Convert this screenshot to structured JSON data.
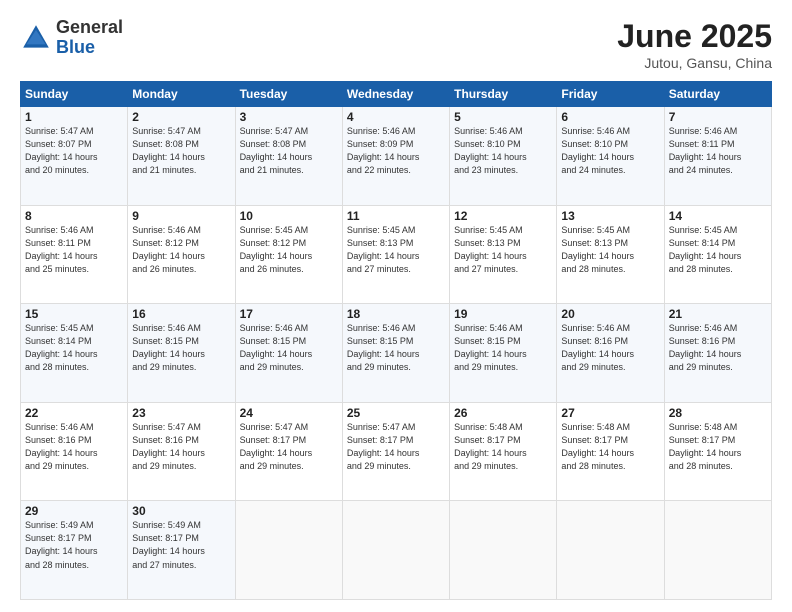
{
  "logo": {
    "general": "General",
    "blue": "Blue"
  },
  "title": {
    "month": "June 2025",
    "location": "Jutou, Gansu, China"
  },
  "weekdays": [
    "Sunday",
    "Monday",
    "Tuesday",
    "Wednesday",
    "Thursday",
    "Friday",
    "Saturday"
  ],
  "weeks": [
    [
      {
        "day": "1",
        "info": "Sunrise: 5:47 AM\nSunset: 8:07 PM\nDaylight: 14 hours\nand 20 minutes."
      },
      {
        "day": "2",
        "info": "Sunrise: 5:47 AM\nSunset: 8:08 PM\nDaylight: 14 hours\nand 21 minutes."
      },
      {
        "day": "3",
        "info": "Sunrise: 5:47 AM\nSunset: 8:08 PM\nDaylight: 14 hours\nand 21 minutes."
      },
      {
        "day": "4",
        "info": "Sunrise: 5:46 AM\nSunset: 8:09 PM\nDaylight: 14 hours\nand 22 minutes."
      },
      {
        "day": "5",
        "info": "Sunrise: 5:46 AM\nSunset: 8:10 PM\nDaylight: 14 hours\nand 23 minutes."
      },
      {
        "day": "6",
        "info": "Sunrise: 5:46 AM\nSunset: 8:10 PM\nDaylight: 14 hours\nand 24 minutes."
      },
      {
        "day": "7",
        "info": "Sunrise: 5:46 AM\nSunset: 8:11 PM\nDaylight: 14 hours\nand 24 minutes."
      }
    ],
    [
      {
        "day": "8",
        "info": "Sunrise: 5:46 AM\nSunset: 8:11 PM\nDaylight: 14 hours\nand 25 minutes."
      },
      {
        "day": "9",
        "info": "Sunrise: 5:46 AM\nSunset: 8:12 PM\nDaylight: 14 hours\nand 26 minutes."
      },
      {
        "day": "10",
        "info": "Sunrise: 5:45 AM\nSunset: 8:12 PM\nDaylight: 14 hours\nand 26 minutes."
      },
      {
        "day": "11",
        "info": "Sunrise: 5:45 AM\nSunset: 8:13 PM\nDaylight: 14 hours\nand 27 minutes."
      },
      {
        "day": "12",
        "info": "Sunrise: 5:45 AM\nSunset: 8:13 PM\nDaylight: 14 hours\nand 27 minutes."
      },
      {
        "day": "13",
        "info": "Sunrise: 5:45 AM\nSunset: 8:13 PM\nDaylight: 14 hours\nand 28 minutes."
      },
      {
        "day": "14",
        "info": "Sunrise: 5:45 AM\nSunset: 8:14 PM\nDaylight: 14 hours\nand 28 minutes."
      }
    ],
    [
      {
        "day": "15",
        "info": "Sunrise: 5:45 AM\nSunset: 8:14 PM\nDaylight: 14 hours\nand 28 minutes."
      },
      {
        "day": "16",
        "info": "Sunrise: 5:46 AM\nSunset: 8:15 PM\nDaylight: 14 hours\nand 29 minutes."
      },
      {
        "day": "17",
        "info": "Sunrise: 5:46 AM\nSunset: 8:15 PM\nDaylight: 14 hours\nand 29 minutes."
      },
      {
        "day": "18",
        "info": "Sunrise: 5:46 AM\nSunset: 8:15 PM\nDaylight: 14 hours\nand 29 minutes."
      },
      {
        "day": "19",
        "info": "Sunrise: 5:46 AM\nSunset: 8:15 PM\nDaylight: 14 hours\nand 29 minutes."
      },
      {
        "day": "20",
        "info": "Sunrise: 5:46 AM\nSunset: 8:16 PM\nDaylight: 14 hours\nand 29 minutes."
      },
      {
        "day": "21",
        "info": "Sunrise: 5:46 AM\nSunset: 8:16 PM\nDaylight: 14 hours\nand 29 minutes."
      }
    ],
    [
      {
        "day": "22",
        "info": "Sunrise: 5:46 AM\nSunset: 8:16 PM\nDaylight: 14 hours\nand 29 minutes."
      },
      {
        "day": "23",
        "info": "Sunrise: 5:47 AM\nSunset: 8:16 PM\nDaylight: 14 hours\nand 29 minutes."
      },
      {
        "day": "24",
        "info": "Sunrise: 5:47 AM\nSunset: 8:17 PM\nDaylight: 14 hours\nand 29 minutes."
      },
      {
        "day": "25",
        "info": "Sunrise: 5:47 AM\nSunset: 8:17 PM\nDaylight: 14 hours\nand 29 minutes."
      },
      {
        "day": "26",
        "info": "Sunrise: 5:48 AM\nSunset: 8:17 PM\nDaylight: 14 hours\nand 29 minutes."
      },
      {
        "day": "27",
        "info": "Sunrise: 5:48 AM\nSunset: 8:17 PM\nDaylight: 14 hours\nand 28 minutes."
      },
      {
        "day": "28",
        "info": "Sunrise: 5:48 AM\nSunset: 8:17 PM\nDaylight: 14 hours\nand 28 minutes."
      }
    ],
    [
      {
        "day": "29",
        "info": "Sunrise: 5:49 AM\nSunset: 8:17 PM\nDaylight: 14 hours\nand 28 minutes."
      },
      {
        "day": "30",
        "info": "Sunrise: 5:49 AM\nSunset: 8:17 PM\nDaylight: 14 hours\nand 27 minutes."
      },
      {
        "day": "",
        "info": ""
      },
      {
        "day": "",
        "info": ""
      },
      {
        "day": "",
        "info": ""
      },
      {
        "day": "",
        "info": ""
      },
      {
        "day": "",
        "info": ""
      }
    ]
  ]
}
